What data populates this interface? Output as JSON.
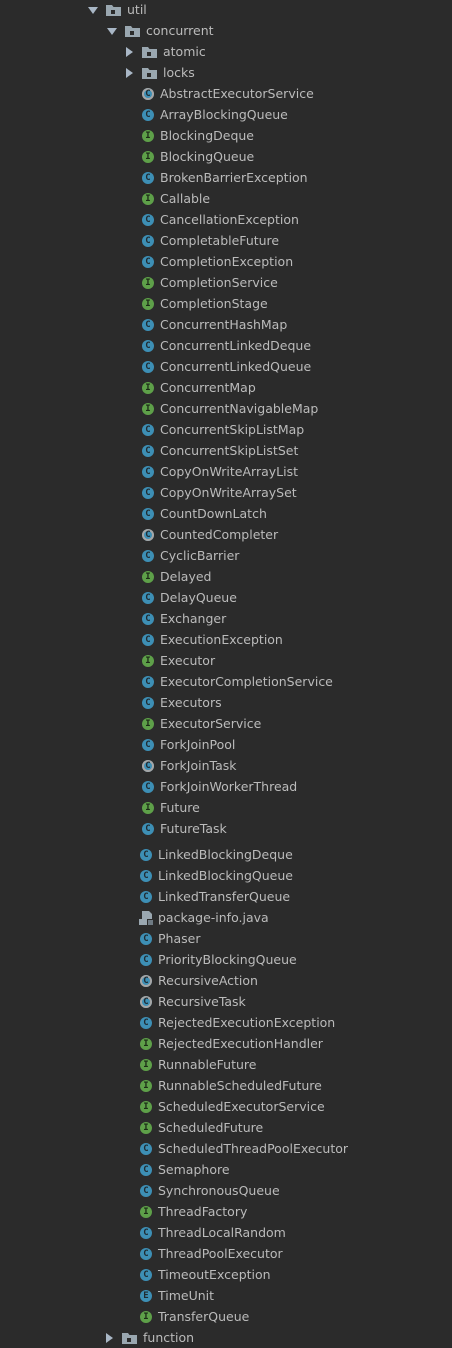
{
  "colors": {
    "background": "#2b2b2b",
    "text": "#bbbbbb",
    "class": "#3d8fb5",
    "interface": "#5ea049"
  },
  "tree": {
    "util": {
      "label": "util",
      "icon": "package-folder-icon",
      "expanded": true
    },
    "concurrent": {
      "label": "concurrent",
      "icon": "package-folder-icon",
      "expanded": true
    },
    "subpackages": [
      {
        "label": "atomic",
        "expanded": false
      },
      {
        "label": "locks",
        "expanded": false
      }
    ],
    "files": [
      {
        "label": "AbstractExecutorService",
        "kind": "abstract",
        "glyph": "C"
      },
      {
        "label": "ArrayBlockingQueue",
        "kind": "class",
        "glyph": "C"
      },
      {
        "label": "BlockingDeque",
        "kind": "interface",
        "glyph": "I"
      },
      {
        "label": "BlockingQueue",
        "kind": "interface",
        "glyph": "I"
      },
      {
        "label": "BrokenBarrierException",
        "kind": "class",
        "glyph": "C"
      },
      {
        "label": "Callable",
        "kind": "interface",
        "glyph": "I"
      },
      {
        "label": "CancellationException",
        "kind": "class",
        "glyph": "C"
      },
      {
        "label": "CompletableFuture",
        "kind": "class",
        "glyph": "C"
      },
      {
        "label": "CompletionException",
        "kind": "class",
        "glyph": "C"
      },
      {
        "label": "CompletionService",
        "kind": "interface",
        "glyph": "I"
      },
      {
        "label": "CompletionStage",
        "kind": "interface",
        "glyph": "I"
      },
      {
        "label": "ConcurrentHashMap",
        "kind": "class",
        "glyph": "C"
      },
      {
        "label": "ConcurrentLinkedDeque",
        "kind": "class",
        "glyph": "C"
      },
      {
        "label": "ConcurrentLinkedQueue",
        "kind": "class",
        "glyph": "C"
      },
      {
        "label": "ConcurrentMap",
        "kind": "interface",
        "glyph": "I"
      },
      {
        "label": "ConcurrentNavigableMap",
        "kind": "interface",
        "glyph": "I"
      },
      {
        "label": "ConcurrentSkipListMap",
        "kind": "class",
        "glyph": "C"
      },
      {
        "label": "ConcurrentSkipListSet",
        "kind": "class",
        "glyph": "C"
      },
      {
        "label": "CopyOnWriteArrayList",
        "kind": "class",
        "glyph": "C"
      },
      {
        "label": "CopyOnWriteArraySet",
        "kind": "class",
        "glyph": "C"
      },
      {
        "label": "CountDownLatch",
        "kind": "class",
        "glyph": "C"
      },
      {
        "label": "CountedCompleter",
        "kind": "abstract",
        "glyph": "C"
      },
      {
        "label": "CyclicBarrier",
        "kind": "class",
        "glyph": "C"
      },
      {
        "label": "Delayed",
        "kind": "interface",
        "glyph": "I"
      },
      {
        "label": "DelayQueue",
        "kind": "class",
        "glyph": "C"
      },
      {
        "label": "Exchanger",
        "kind": "class",
        "glyph": "C"
      },
      {
        "label": "ExecutionException",
        "kind": "class",
        "glyph": "C"
      },
      {
        "label": "Executor",
        "kind": "interface",
        "glyph": "I"
      },
      {
        "label": "ExecutorCompletionService",
        "kind": "class",
        "glyph": "C"
      },
      {
        "label": "Executors",
        "kind": "class",
        "glyph": "C"
      },
      {
        "label": "ExecutorService",
        "kind": "interface",
        "glyph": "I"
      },
      {
        "label": "ForkJoinPool",
        "kind": "class",
        "glyph": "C"
      },
      {
        "label": "ForkJoinTask",
        "kind": "abstract",
        "glyph": "C"
      },
      {
        "label": "ForkJoinWorkerThread",
        "kind": "class",
        "glyph": "C"
      },
      {
        "label": "Future",
        "kind": "interface",
        "glyph": "I"
      },
      {
        "label": "FutureTask",
        "kind": "class",
        "glyph": "C"
      }
    ],
    "files2": [
      {
        "label": "LinkedBlockingDeque",
        "kind": "class",
        "glyph": "C"
      },
      {
        "label": "LinkedBlockingQueue",
        "kind": "class",
        "glyph": "C"
      },
      {
        "label": "LinkedTransferQueue",
        "kind": "class",
        "glyph": "C"
      },
      {
        "label": "package-info.java",
        "kind": "file",
        "glyph": ""
      },
      {
        "label": "Phaser",
        "kind": "class",
        "glyph": "C"
      },
      {
        "label": "PriorityBlockingQueue",
        "kind": "class",
        "glyph": "C"
      },
      {
        "label": "RecursiveAction",
        "kind": "abstract",
        "glyph": "C"
      },
      {
        "label": "RecursiveTask",
        "kind": "abstract",
        "glyph": "C"
      },
      {
        "label": "RejectedExecutionException",
        "kind": "class",
        "glyph": "C"
      },
      {
        "label": "RejectedExecutionHandler",
        "kind": "interface",
        "glyph": "I"
      },
      {
        "label": "RunnableFuture",
        "kind": "interface",
        "glyph": "I"
      },
      {
        "label": "RunnableScheduledFuture",
        "kind": "interface",
        "glyph": "I"
      },
      {
        "label": "ScheduledExecutorService",
        "kind": "interface",
        "glyph": "I"
      },
      {
        "label": "ScheduledFuture",
        "kind": "interface",
        "glyph": "I"
      },
      {
        "label": "ScheduledThreadPoolExecutor",
        "kind": "class",
        "glyph": "C"
      },
      {
        "label": "Semaphore",
        "kind": "class",
        "glyph": "C"
      },
      {
        "label": "SynchronousQueue",
        "kind": "class",
        "glyph": "C"
      },
      {
        "label": "ThreadFactory",
        "kind": "interface",
        "glyph": "I"
      },
      {
        "label": "ThreadLocalRandom",
        "kind": "class",
        "glyph": "C"
      },
      {
        "label": "ThreadPoolExecutor",
        "kind": "class",
        "glyph": "C"
      },
      {
        "label": "TimeoutException",
        "kind": "class",
        "glyph": "C"
      },
      {
        "label": "TimeUnit",
        "kind": "enum",
        "glyph": "E"
      },
      {
        "label": "TransferQueue",
        "kind": "interface",
        "glyph": "I"
      }
    ],
    "function": {
      "label": "function",
      "expanded": false
    }
  }
}
